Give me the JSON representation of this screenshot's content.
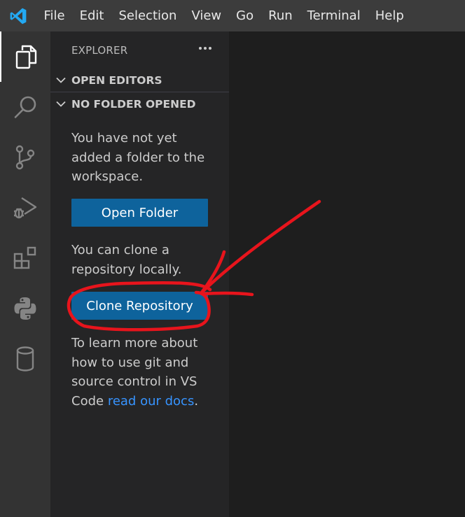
{
  "menubar": {
    "items": [
      "File",
      "Edit",
      "Selection",
      "View",
      "Go",
      "Run",
      "Terminal",
      "Help"
    ]
  },
  "activitybar": {
    "icons": [
      "explorer-icon",
      "search-icon",
      "source-control-icon",
      "run-debug-icon",
      "extensions-icon",
      "python-icon",
      "database-icon"
    ]
  },
  "sidebar": {
    "title": "EXPLORER",
    "sections": {
      "open_editors": "OPEN EDITORS",
      "no_folder": "NO FOLDER OPENED"
    },
    "welcome": {
      "text1": "You have not yet added a folder to the workspace.",
      "open_folder_label": "Open Folder",
      "text2": "You can clone a repository locally.",
      "clone_label": "Clone Repository",
      "text3_prefix": "To learn more about how to use git and source control in VS Code ",
      "docs_link": "read our docs",
      "text3_suffix": "."
    }
  },
  "colors": {
    "button_bg": "#0e639c",
    "link": "#3794ff",
    "annotation": "#e8141c"
  }
}
